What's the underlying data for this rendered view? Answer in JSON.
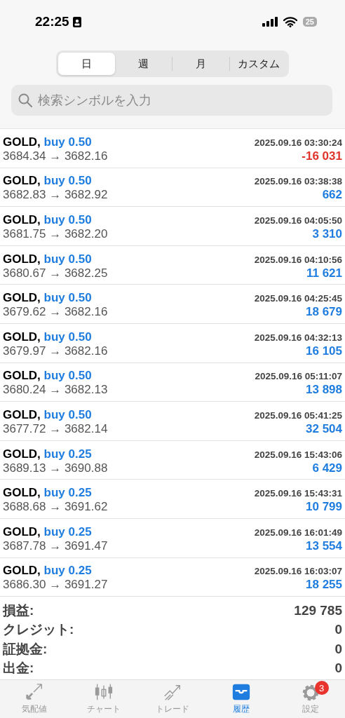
{
  "status_bar": {
    "time": "22:25",
    "battery": "25"
  },
  "period_tabs": [
    {
      "label": "日",
      "selected": true
    },
    {
      "label": "週",
      "selected": false
    },
    {
      "label": "月",
      "selected": false
    },
    {
      "label": "カスタム",
      "selected": false
    }
  ],
  "search": {
    "placeholder": "検索シンボルを入力"
  },
  "deals": [
    {
      "symbol": "GOLD,",
      "side": "buy 0.50",
      "time": "2025.09.16 03:30:24",
      "prices": "3684.34 → 3682.16",
      "profit": "-16 031",
      "kind": "loss"
    },
    {
      "symbol": "GOLD,",
      "side": "buy 0.50",
      "time": "2025.09.16 03:38:38",
      "prices": "3682.83 → 3682.92",
      "profit": "662",
      "kind": "gain"
    },
    {
      "symbol": "GOLD,",
      "side": "buy 0.50",
      "time": "2025.09.16 04:05:50",
      "prices": "3681.75 → 3682.20",
      "profit": "3 310",
      "kind": "gain"
    },
    {
      "symbol": "GOLD,",
      "side": "buy 0.50",
      "time": "2025.09.16 04:10:56",
      "prices": "3680.67 → 3682.25",
      "profit": "11 621",
      "kind": "gain"
    },
    {
      "symbol": "GOLD,",
      "side": "buy 0.50",
      "time": "2025.09.16 04:25:45",
      "prices": "3679.62 → 3682.16",
      "profit": "18 679",
      "kind": "gain"
    },
    {
      "symbol": "GOLD,",
      "side": "buy 0.50",
      "time": "2025.09.16 04:32:13",
      "prices": "3679.97 → 3682.16",
      "profit": "16 105",
      "kind": "gain"
    },
    {
      "symbol": "GOLD,",
      "side": "buy 0.50",
      "time": "2025.09.16 05:11:07",
      "prices": "3680.24 → 3682.13",
      "profit": "13 898",
      "kind": "gain"
    },
    {
      "symbol": "GOLD,",
      "side": "buy 0.50",
      "time": "2025.09.16 05:41:25",
      "prices": "3677.72 → 3682.14",
      "profit": "32 504",
      "kind": "gain"
    },
    {
      "symbol": "GOLD,",
      "side": "buy 0.25",
      "time": "2025.09.16 15:43:06",
      "prices": "3689.13 → 3690.88",
      "profit": "6 429",
      "kind": "gain"
    },
    {
      "symbol": "GOLD,",
      "side": "buy 0.25",
      "time": "2025.09.16 15:43:31",
      "prices": "3688.68 → 3691.62",
      "profit": "10 799",
      "kind": "gain"
    },
    {
      "symbol": "GOLD,",
      "side": "buy 0.25",
      "time": "2025.09.16 16:01:49",
      "prices": "3687.78 → 3691.47",
      "profit": "13 554",
      "kind": "gain"
    },
    {
      "symbol": "GOLD,",
      "side": "buy 0.25",
      "time": "2025.09.16 16:03:07",
      "prices": "3686.30 → 3691.27",
      "profit": "18 255",
      "kind": "gain"
    }
  ],
  "summary": [
    {
      "label": "損益:",
      "value": "129 785"
    },
    {
      "label": "クレジット:",
      "value": "0"
    },
    {
      "label": "証拠金:",
      "value": "0"
    },
    {
      "label": "出金:",
      "value": "0"
    }
  ],
  "tab_bar": [
    {
      "label": "気配値",
      "selected": false
    },
    {
      "label": "チャート",
      "selected": false
    },
    {
      "label": "トレード",
      "selected": false
    },
    {
      "label": "履歴",
      "selected": true
    },
    {
      "label": "設定",
      "selected": false,
      "badge": "3"
    }
  ]
}
